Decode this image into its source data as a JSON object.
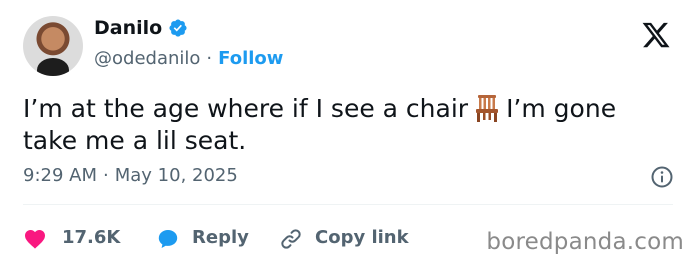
{
  "author": {
    "name": "Danilo",
    "handle": "@odedanilo",
    "follow_label": "Follow",
    "verified": true
  },
  "tweet": {
    "text_before_emoji": "I’m at the age where if I see a chair",
    "emoji": "chair",
    "text_after_emoji": "I’m gone take me a lil seat.",
    "time": "9:29 AM",
    "date": "May 10, 2025"
  },
  "actions": {
    "like_count": "17.6K",
    "reply_label": "Reply",
    "copy_link_label": "Copy link"
  },
  "watermark": "boredpanda.com",
  "colors": {
    "accent": "#1d9bf0",
    "like": "#f91880",
    "text": "#0f1419",
    "muted": "#536471"
  },
  "icons": [
    "verified-badge-icon",
    "x-logo-icon",
    "chair-emoji-icon",
    "info-icon",
    "heart-icon",
    "reply-bubble-icon",
    "link-icon"
  ]
}
